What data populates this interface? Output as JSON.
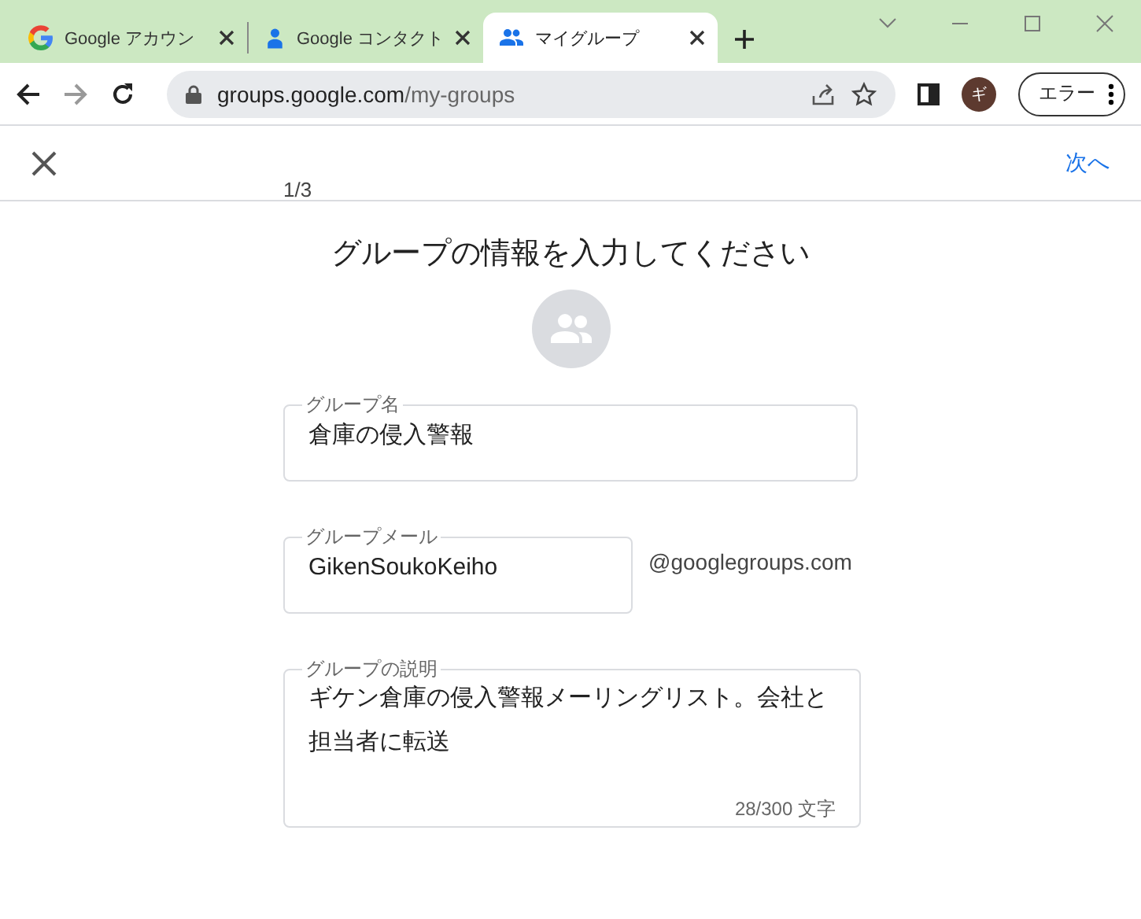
{
  "browser": {
    "tabs": [
      {
        "title": "Google アカウン",
        "selected": false
      },
      {
        "title": "Google コンタクト",
        "selected": false
      },
      {
        "title": "マイグループ",
        "selected": true
      }
    ],
    "url_host": "groups.google.com",
    "url_path": "/my-groups",
    "profile_initial": "ギ",
    "profile_status": "エラー"
  },
  "page": {
    "next_label": "次へ",
    "step": "1/3",
    "title": "グループの情報を入力してください",
    "fields": [
      {
        "kind": "text",
        "label": "グループ名",
        "value": "倉庫の侵入警報"
      },
      {
        "kind": "email",
        "label": "グループメール",
        "value": "GikenSoukoKeiho",
        "suffix": "@googlegroups.com"
      },
      {
        "kind": "textarea",
        "label": "グループの説明",
        "value": "ギケン倉庫の侵入警報メーリングリスト。会社と担当者に転送",
        "counter": "28/300 文字"
      }
    ]
  }
}
